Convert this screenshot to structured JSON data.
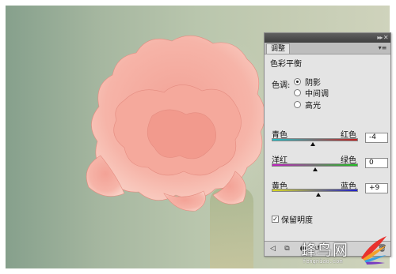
{
  "panel": {
    "tab_label": "调整",
    "heading": "色彩平衡",
    "tone_label": "色调:",
    "tone_options": [
      {
        "label": "阴影",
        "selected": true
      },
      {
        "label": "中间调",
        "selected": false
      },
      {
        "label": "高光",
        "selected": false
      }
    ],
    "sliders": [
      {
        "left_label": "青色",
        "right_label": "红色",
        "value": "-4",
        "value_num": -4,
        "gradient": [
          "#20c0c8",
          "#c82020"
        ]
      },
      {
        "left_label": "洋红",
        "right_label": "绿色",
        "value": "0",
        "value_num": 0,
        "gradient": [
          "#c020c0",
          "#20c020"
        ]
      },
      {
        "left_label": "黄色",
        "right_label": "蓝色",
        "value": "+9",
        "value_num": 9,
        "gradient": [
          "#d8d820",
          "#2020c8"
        ]
      }
    ],
    "preserve_luminosity": {
      "label": "保留明度",
      "checked": true
    },
    "bottom_tools": [
      "back-arrow-icon",
      "clip-layer-icon",
      "visibility-eye-icon",
      "reset-icon",
      "delete-icon"
    ]
  },
  "watermark": {
    "text": "蜂鸟网",
    "url": "fengniao.com"
  }
}
